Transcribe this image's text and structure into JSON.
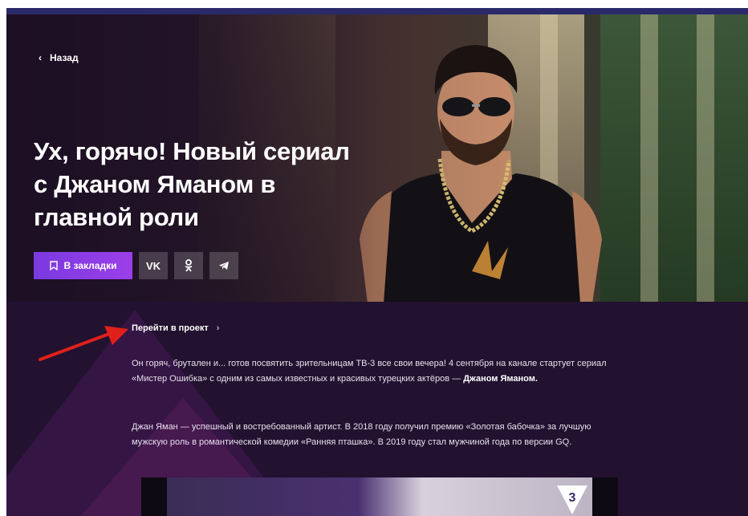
{
  "hero": {
    "back_label": "Назад",
    "title_lines": [
      "Ух, горячо! Новый сериал",
      "с Джаном Яманом в",
      "главной роли"
    ],
    "bookmark_label": "В закладки",
    "share": {
      "vk": "VK",
      "ok": "ОК",
      "telegram": "telegram-icon"
    }
  },
  "content": {
    "project_link": "Перейти в проект",
    "paragraph1": {
      "text": "Он горяч, брутален и... готов посвятить зрительницам ТВ-3 все свои вечера! 4 сентября на канале стартует сериал «Мистер Ошибка» с одним из самых известных и красивых турецких актёров —",
      "bold": "Джаном Яманом."
    },
    "paragraph2": "Джан Яман — успешный и востребованный артист. В 2018 году получил премию «Золотая бабочка» за лучшую мужскую роль в романтической комедии «Ранняя пташка». В 2019 году стал мужчиной года по версии GQ.",
    "video_logo": "3"
  },
  "colors": {
    "accent": "#8a3ce6",
    "page_bg": "#22112f",
    "arrow": "#e0201a"
  }
}
